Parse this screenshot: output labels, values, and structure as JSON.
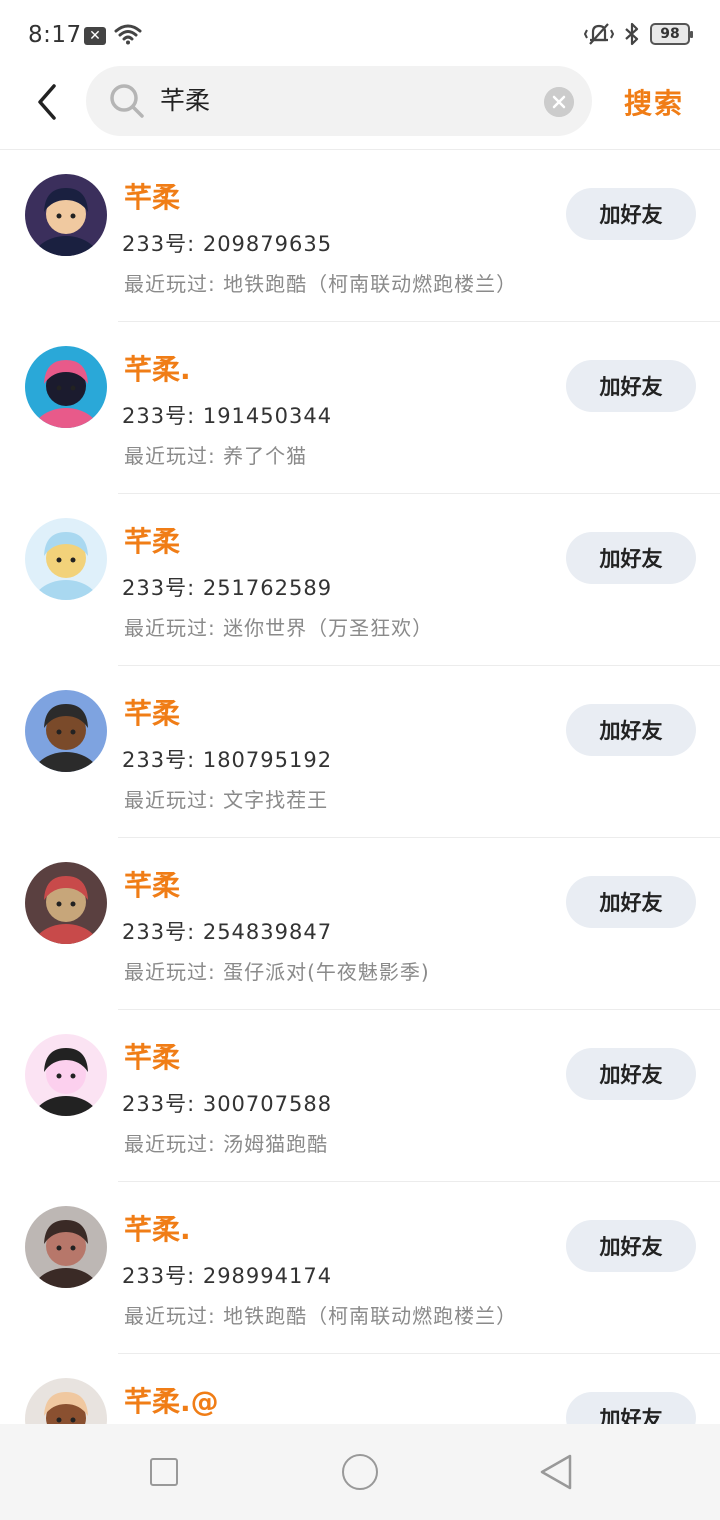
{
  "status_bar": {
    "time": "8:17",
    "notif_icon": "x-box-icon",
    "battery": "98"
  },
  "header": {
    "search_value": "芊柔",
    "search_button": "搜索"
  },
  "results": [
    {
      "name": "芊柔",
      "uid": "233号: 209879635",
      "recent": "最近玩过: 地铁跑酷（柯南联动燃跑楼兰）",
      "add_label": "加好友",
      "avatar_colors": [
        "#3b2f5c",
        "#f0c9a0",
        "#1a2040"
      ]
    },
    {
      "name": "芊柔.",
      "uid": "233号: 191450344",
      "recent": "最近玩过: 养了个猫",
      "add_label": "加好友",
      "avatar_colors": [
        "#2aa8d8",
        "#1b1b2e",
        "#e85a8a"
      ]
    },
    {
      "name": "芊柔",
      "uid": "233号: 251762589",
      "recent": "最近玩过: 迷你世界（万圣狂欢）",
      "add_label": "加好友",
      "avatar_colors": [
        "#dff0fa",
        "#f2d27a",
        "#a9d8f0"
      ]
    },
    {
      "name": "芊柔",
      "uid": "233号: 180795192",
      "recent": "最近玩过: 文字找茬王",
      "add_label": "加好友",
      "avatar_colors": [
        "#7ea3e0",
        "#7a4a2a",
        "#2b2b2b"
      ]
    },
    {
      "name": "芊柔",
      "uid": "233号: 254839847",
      "recent": "最近玩过: 蛋仔派对(午夜魅影季)",
      "add_label": "加好友",
      "avatar_colors": [
        "#5a4040",
        "#c7a67a",
        "#c84a4a"
      ]
    },
    {
      "name": "芊柔",
      "uid": "233号: 300707588",
      "recent": "最近玩过: 汤姆猫跑酷",
      "add_label": "加好友",
      "avatar_colors": [
        "#fbe3f3",
        "#fcd0ee",
        "#222222"
      ]
    },
    {
      "name": "芊柔.",
      "uid": "233号: 298994174",
      "recent": "最近玩过: 地铁跑酷（柯南联动燃跑楼兰）",
      "add_label": "加好友",
      "avatar_colors": [
        "#bdb7b4",
        "#b7776a",
        "#3a2a26"
      ]
    },
    {
      "name": "芊柔.@",
      "uid": "",
      "recent": "",
      "add_label": "加好友",
      "avatar_colors": [
        "#e8e3df",
        "#8a5030",
        "#f0c8a0"
      ]
    }
  ],
  "colors": {
    "accent": "#f07d16",
    "button_bg": "#e9edf3"
  }
}
